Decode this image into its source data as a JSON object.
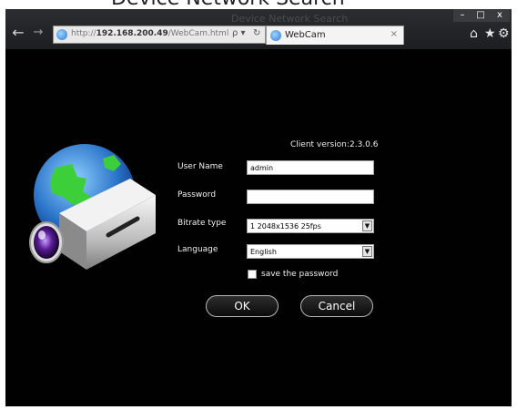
{
  "page_heading": "Device Network Search",
  "browser": {
    "url_prefix": "http://",
    "url_host": "192.168.200.49",
    "url_path": "/WebCam.html",
    "addr_search": "ρ ▾",
    "addr_refresh": "↻",
    "tab_title": "WebCam",
    "tab_close": "×",
    "win_min": "–",
    "win_max": "□",
    "win_close": "x",
    "back_glyph": "←",
    "forward_glyph": "→",
    "home_glyph": "⌂",
    "star_glyph": "★",
    "gear_glyph": "⚙"
  },
  "login": {
    "client_version_label": "Client version:",
    "client_version": "2.3.0.6",
    "username_label": "User Name",
    "username_value": "admin",
    "password_label": "Password",
    "password_value": "",
    "bitrate_label": "Bitrate type",
    "bitrate_value": "1 2048x1536 25fps",
    "language_label": "Language",
    "language_value": "English",
    "save_password_label": "save the password",
    "save_password_checked": false,
    "ok_label": "OK",
    "cancel_label": "Cancel"
  }
}
